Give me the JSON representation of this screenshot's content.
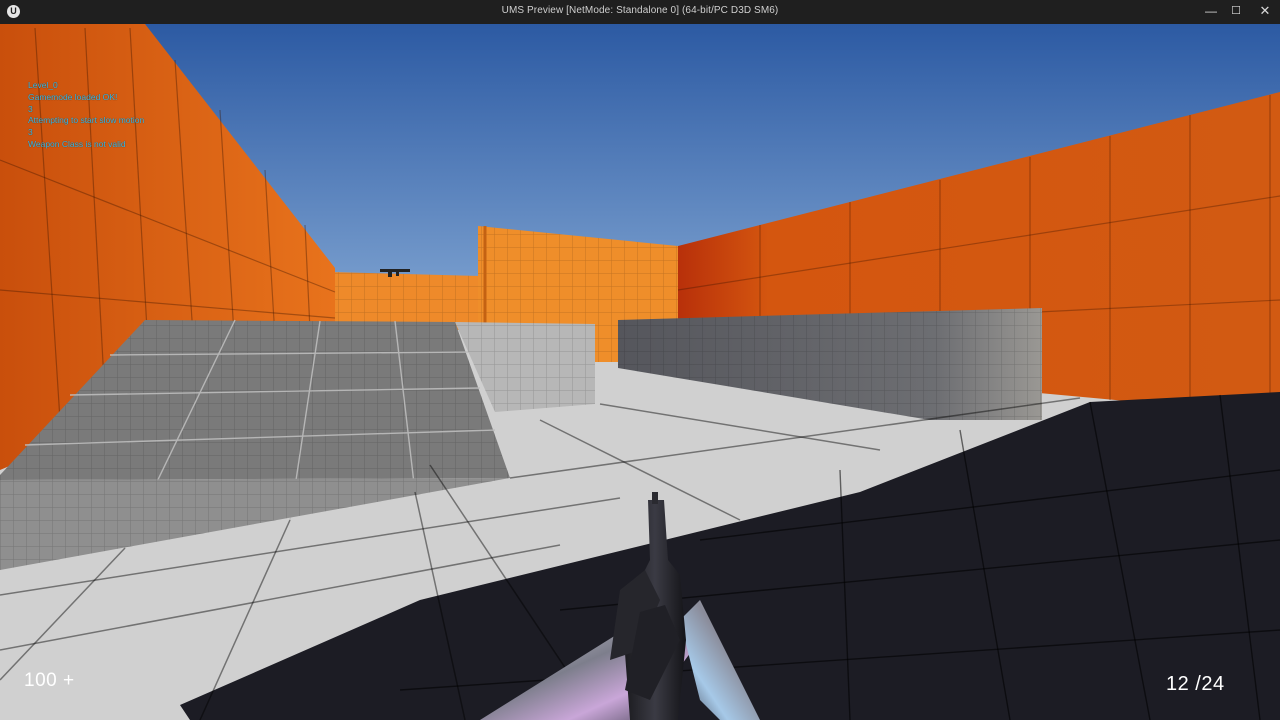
{
  "window": {
    "title": "UMS Preview [NetMode: Standalone 0]  (64-bit/PC D3D SM6)",
    "logo_glyph": "U",
    "minimize_glyph": "—",
    "maximize_glyph": "☐",
    "close_glyph": "✕"
  },
  "debug_log": [
    "Level_0",
    "Gamemode loaded OK!",
    "3",
    "Attempting to start slow motion",
    "3",
    "Weapon Class is not valid"
  ],
  "hud": {
    "health": "100 +",
    "ammo": "12 /24"
  },
  "colors": {
    "sky_top": "#2e5fa8",
    "sky_horizon": "#8fb2db",
    "wall_orange": "#e36a16",
    "floor_light": "#cdcdcd",
    "floor_shadow": "#1d1d26",
    "debug_text": "#35b7e6"
  }
}
